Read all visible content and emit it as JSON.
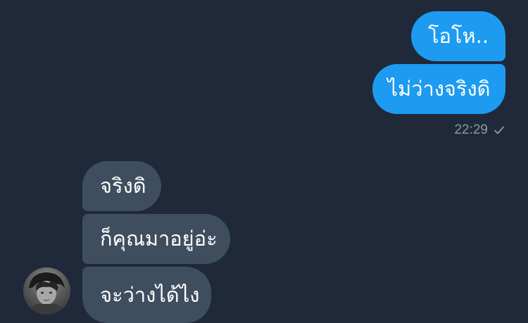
{
  "messages": {
    "outgoing": [
      {
        "text": "โอโห.."
      },
      {
        "text": "ไม่ว่างจริงดิ"
      }
    ],
    "incoming": [
      {
        "text": "จริงดิ"
      },
      {
        "text": "ก็คุณมาอยู่อ่ะ"
      },
      {
        "text": "จะว่างได้ไง"
      }
    ]
  },
  "status": {
    "time": "22:29",
    "state_icon": "check-icon"
  },
  "colors": {
    "background": "#1f2939",
    "outgoing_bubble": "#1d9bf0",
    "incoming_bubble": "#3f4e5f",
    "text": "#ffffff",
    "meta_text": "#8b98a5"
  }
}
